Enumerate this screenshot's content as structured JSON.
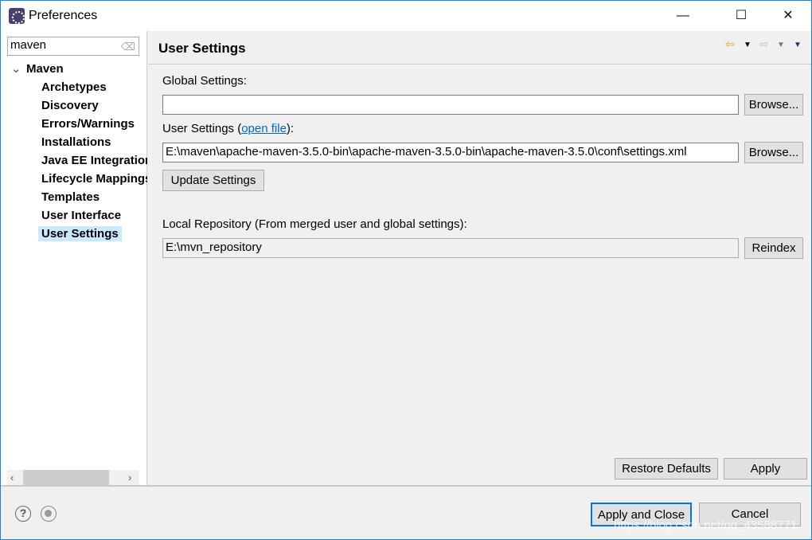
{
  "window": {
    "title": "Preferences",
    "minimize": "—",
    "maximize": "☐",
    "close": "✕"
  },
  "sidebar": {
    "search_value": "maven",
    "tree": [
      {
        "label": "Maven",
        "expanded": true
      },
      {
        "label": "Archetypes"
      },
      {
        "label": "Discovery"
      },
      {
        "label": "Errors/Warnings"
      },
      {
        "label": "Installations"
      },
      {
        "label": "Java EE Integration"
      },
      {
        "label": "Lifecycle Mappings"
      },
      {
        "label": "Templates"
      },
      {
        "label": "User Interface"
      },
      {
        "label": "User Settings",
        "selected": true
      }
    ]
  },
  "main": {
    "title": "User Settings",
    "global_label": "Global Settings:",
    "global_value": "",
    "user_label_pre": "User Settings (",
    "open_file": "open file",
    "user_label_post": "):",
    "user_value": "E:\\maven\\apache-maven-3.5.0-bin\\apache-maven-3.5.0-bin\\apache-maven-3.5.0\\conf\\settings.xml",
    "browse": "Browse...",
    "update_settings": "Update Settings",
    "local_label": "Local Repository (From merged user and global settings):",
    "local_value": "E:\\mvn_repository",
    "reindex": "Reindex",
    "restore_defaults": "Restore Defaults",
    "apply": "Apply"
  },
  "footer": {
    "apply_close": "Apply and Close",
    "cancel": "Cancel",
    "watermark": "https://blog.csdn.net/qq_43588771"
  },
  "colors": {
    "accent": "#0078d7",
    "selection": "#cce8ff",
    "back_arrow": "#e8a317"
  }
}
